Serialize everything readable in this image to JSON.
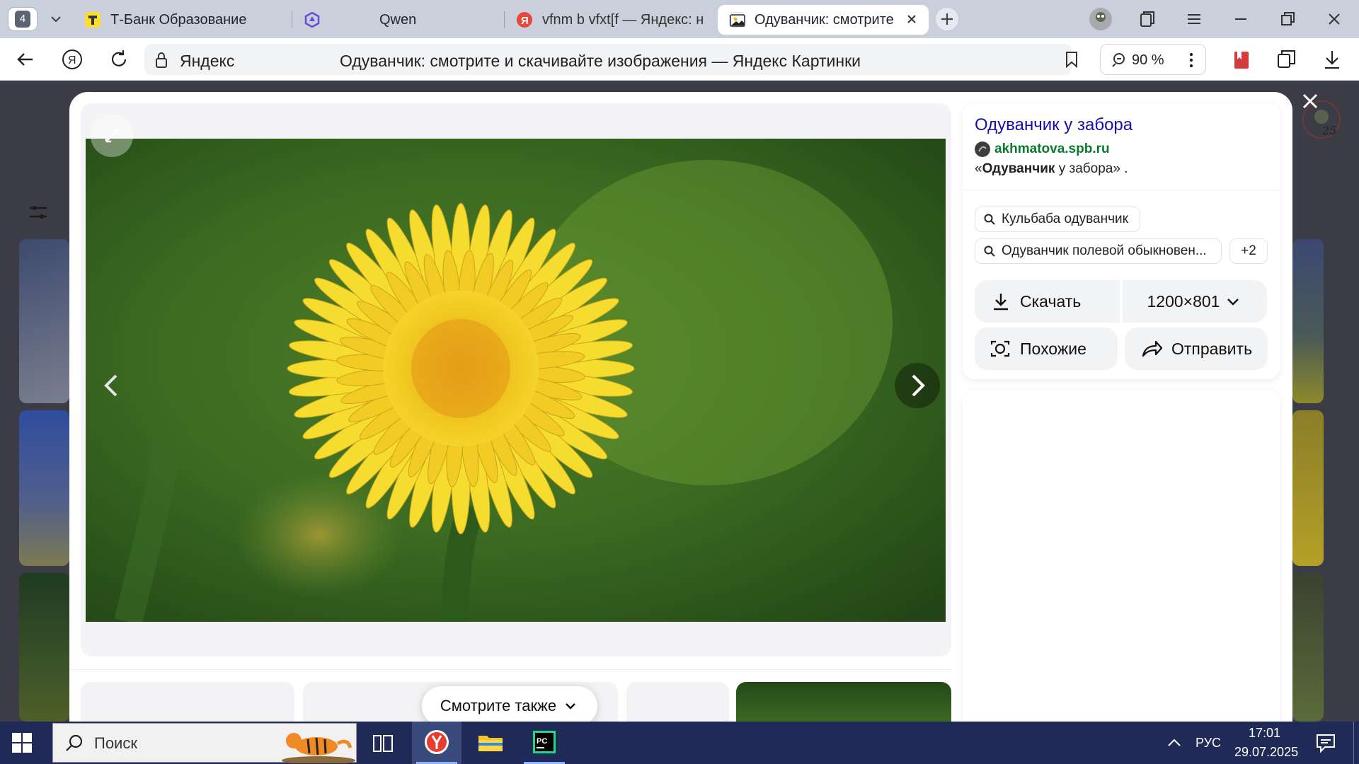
{
  "browser": {
    "tab_count": "4",
    "tabs": [
      {
        "title": "Т-Банк Образование",
        "favicon": "tbank-icon"
      },
      {
        "title": "Qwen",
        "favicon": "qwen-icon"
      },
      {
        "title": "vfnm b vfxt[f — Яндекс: н",
        "favicon": "yandex-icon"
      },
      {
        "title": "Одуванчик: смотрите и ск",
        "favicon": "image-icon",
        "active": true
      }
    ],
    "address": {
      "domain": "Яндекс",
      "page_title": "Одуванчик: смотрите и скачивайте изображения — Яндекс Картинки"
    },
    "zoom": "90 %"
  },
  "viewer": {
    "result_title": "Одуванчик у забора",
    "source_domain": "akhmatova.spb.ru",
    "snippet_open": "«",
    "snippet_bold": "Одуванчик",
    "snippet_rest": " у забора» .",
    "tags": [
      {
        "label": "Кульбаба одуванчик"
      },
      {
        "label": "Одуванчик полевой обыкновен..."
      }
    ],
    "tags_more": "+2",
    "actions": {
      "download": "Скачать",
      "size": "1200×801",
      "similar": "Похожие",
      "share": "Отправить"
    },
    "see_also": "Смотрите также"
  },
  "taskbar": {
    "search_placeholder": "Поиск",
    "language": "РУС",
    "time": "17:01",
    "date": "29.07.2025"
  },
  "colors": {
    "link": "#1a0dab",
    "source_green": "#0a7a2c",
    "taskbar": "#1f2a56"
  }
}
